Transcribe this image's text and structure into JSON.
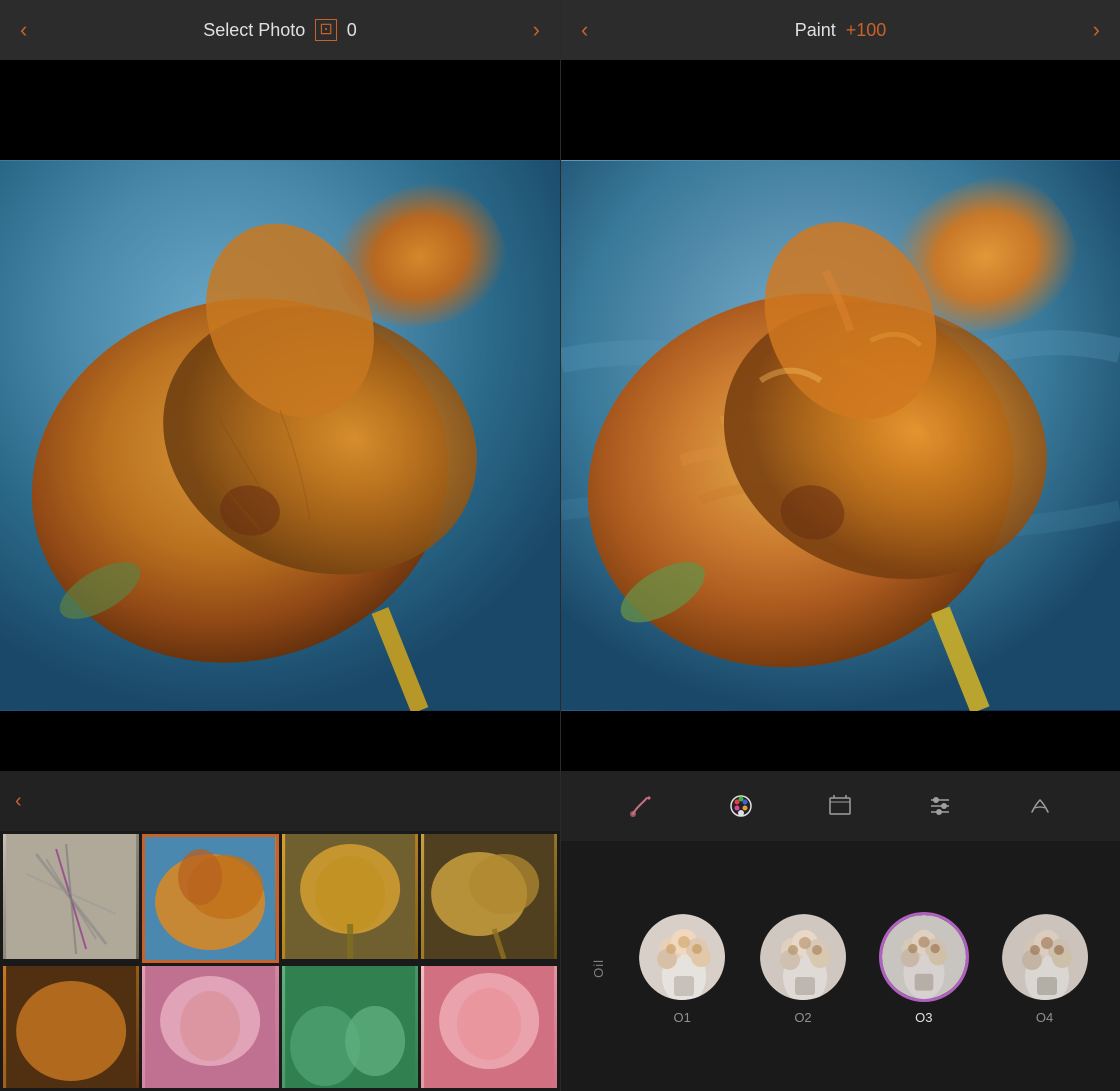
{
  "left_panel": {
    "header": {
      "title": "Select Photo",
      "value_label": "0",
      "back_arrow": "‹",
      "forward_arrow": "›",
      "crop_icon": "crop"
    },
    "thumbnails": [
      {
        "id": "thumb-1",
        "label": "sticks",
        "selected": false,
        "color_class": "thumb-1"
      },
      {
        "id": "thumb-2",
        "label": "dried-tulip",
        "selected": true,
        "color_class": "thumb-2"
      },
      {
        "id": "thumb-3",
        "label": "yellow-flower",
        "selected": false,
        "color_class": "thumb-3"
      },
      {
        "id": "thumb-4",
        "label": "dried-leaves",
        "selected": false,
        "color_class": "thumb-4"
      },
      {
        "id": "thumb-5",
        "label": "brown-leaf",
        "selected": false,
        "color_class": "thumb-5"
      },
      {
        "id": "thumb-6",
        "label": "pink-rose",
        "selected": false,
        "color_class": "thumb-6"
      },
      {
        "id": "thumb-7",
        "label": "green-plant",
        "selected": false,
        "color_class": "thumb-7"
      },
      {
        "id": "thumb-8",
        "label": "pink-flower-2",
        "selected": false,
        "color_class": "thumb-8"
      }
    ]
  },
  "right_panel": {
    "header": {
      "title": "Paint",
      "value": "+100",
      "back_arrow": "‹",
      "forward_arrow": "›"
    },
    "tools": [
      {
        "id": "brush",
        "icon": "brush",
        "active": false
      },
      {
        "id": "palette",
        "icon": "palette",
        "active": true
      },
      {
        "id": "canvas",
        "icon": "canvas",
        "active": false
      },
      {
        "id": "adjustments",
        "icon": "sliders",
        "active": false
      },
      {
        "id": "text",
        "icon": "text",
        "active": false
      }
    ],
    "filter_section": {
      "label": "Oil",
      "filters": [
        {
          "id": "O1",
          "label": "O1",
          "selected": false
        },
        {
          "id": "O2",
          "label": "O2",
          "selected": false
        },
        {
          "id": "O3",
          "label": "O3",
          "selected": true
        },
        {
          "id": "O4",
          "label": "O4",
          "selected": false
        }
      ]
    }
  },
  "colors": {
    "accent": "#c8622a",
    "selected_border": "#b060c0",
    "background": "#1a1a1a",
    "header_bg": "#2c2c2c",
    "text_primary": "#e0e0e0",
    "text_secondary": "#909090"
  }
}
